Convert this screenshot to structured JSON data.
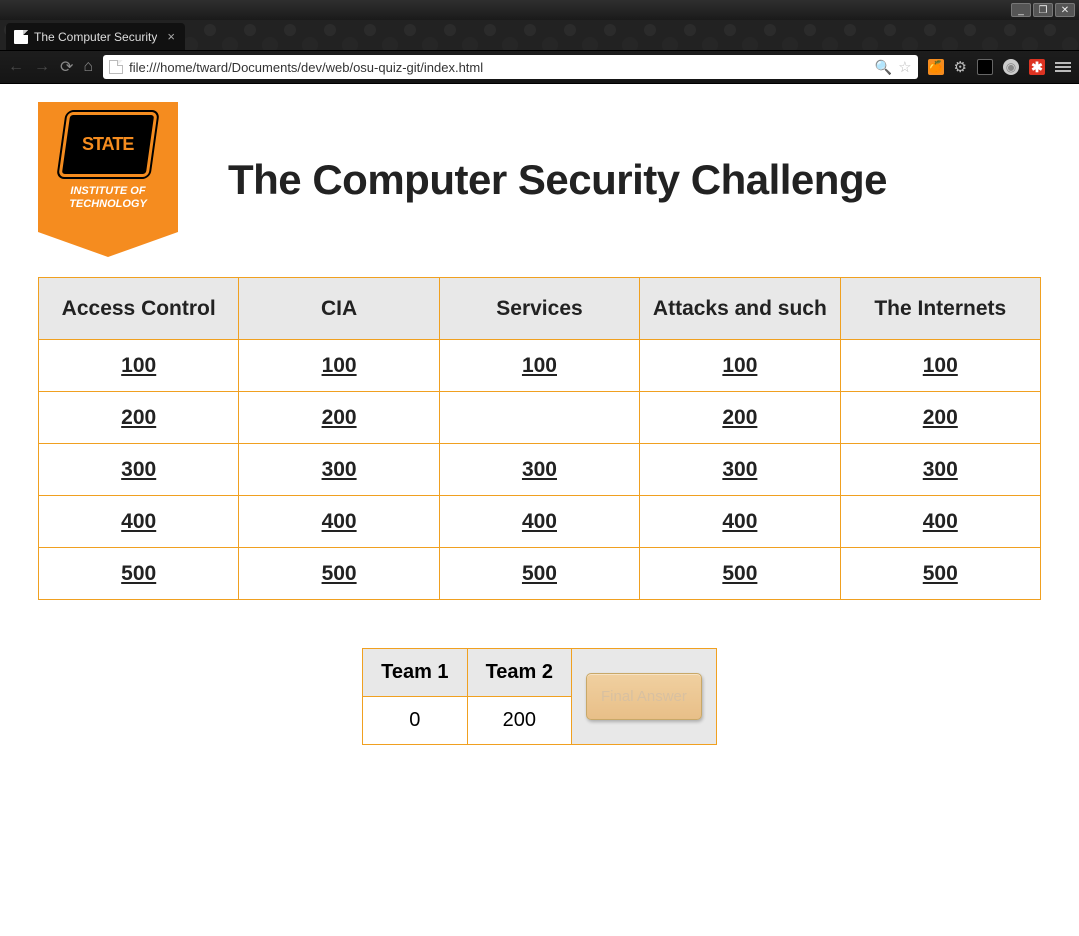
{
  "window": {
    "min": "_",
    "max": "❐",
    "close": "✕"
  },
  "browser": {
    "tab_title": "The Computer Security",
    "url": "file:///home/tward/Documents/dev/web/osu-quiz-git/index.html"
  },
  "logo": {
    "shield_text": "STATE",
    "subtitle_line1": "INSTITUTE OF",
    "subtitle_line2": "TECHNOLOGY"
  },
  "page_title": "The Computer Security Challenge",
  "categories": [
    "Access Control",
    "CIA",
    "Services",
    "Attacks and such",
    "The Internets"
  ],
  "grid": [
    [
      {
        "v": "100",
        "state": "link"
      },
      {
        "v": "100",
        "state": "link"
      },
      {
        "v": "100",
        "state": "link"
      },
      {
        "v": "100",
        "state": "link"
      },
      {
        "v": "100",
        "state": "link"
      }
    ],
    [
      {
        "v": "200",
        "state": "link"
      },
      {
        "v": "200",
        "state": "link"
      },
      {
        "v": "",
        "state": "answered"
      },
      {
        "v": "200",
        "state": "link"
      },
      {
        "v": "200",
        "state": "link"
      }
    ],
    [
      {
        "v": "300",
        "state": "link"
      },
      {
        "v": "300",
        "state": "link"
      },
      {
        "v": "300",
        "state": "link"
      },
      {
        "v": "300",
        "state": "link"
      },
      {
        "v": "300",
        "state": "link"
      }
    ],
    [
      {
        "v": "400",
        "state": "link"
      },
      {
        "v": "400",
        "state": "link"
      },
      {
        "v": "400",
        "state": "link"
      },
      {
        "v": "400",
        "state": "link"
      },
      {
        "v": "400",
        "state": "link"
      }
    ],
    [
      {
        "v": "500",
        "state": "link"
      },
      {
        "v": "500",
        "state": "link"
      },
      {
        "v": "500",
        "state": "link"
      },
      {
        "v": "500",
        "state": "link"
      },
      {
        "v": "500",
        "state": "link"
      }
    ]
  ],
  "score": {
    "team1_label": "Team 1",
    "team2_label": "Team 2",
    "team1_score": "0",
    "team2_score": "200",
    "final_button": "Final Answer"
  }
}
